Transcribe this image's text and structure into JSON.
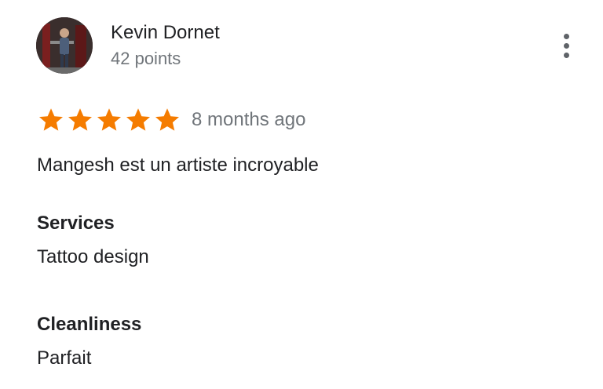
{
  "review": {
    "author": {
      "name": "Kevin Dornet",
      "points": "42 points",
      "avatar_icon": "user-photo"
    },
    "menu_icon": "more-vert-icon",
    "rating": {
      "value": 5,
      "max": 5,
      "star_color": "#f57c00",
      "date": "8 months ago"
    },
    "text": "Mangesh est un artiste incroyable",
    "attributes": [
      {
        "label": "Services",
        "value": "Tattoo design"
      },
      {
        "label": "Cleanliness",
        "value": "Parfait"
      }
    ]
  }
}
